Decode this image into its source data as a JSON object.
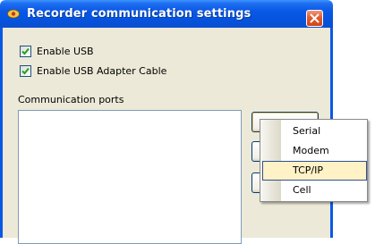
{
  "window": {
    "title": "Recorder communication settings"
  },
  "options": {
    "enable_usb": {
      "label": "Enable USB",
      "checked": true
    },
    "enable_usb_adapter_cable": {
      "label": "Enable USB Adapter Cable",
      "checked": true
    }
  },
  "ports": {
    "group_label": "Communication ports",
    "items": []
  },
  "add_menu": {
    "items": [
      {
        "label": "Serial",
        "selected": false
      },
      {
        "label": "Modem",
        "selected": false
      },
      {
        "label": "TCP/IP",
        "selected": true
      },
      {
        "label": "Cell",
        "selected": false
      }
    ]
  },
  "colors": {
    "titlebar": "#0a58e6",
    "dialog_face": "#ece9d8",
    "menu_highlight": "#fff2c6",
    "menu_highlight_border": "#31508f",
    "close_button": "#e25a2e"
  }
}
